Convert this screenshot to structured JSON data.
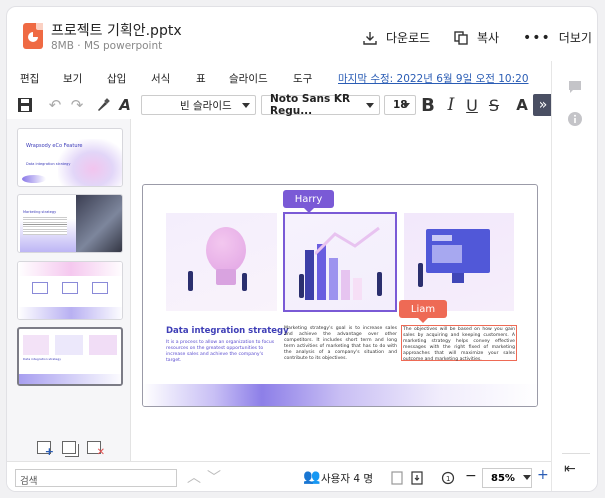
{
  "header": {
    "file_name": "프로젝트 기획안.pptx",
    "file_meta": "8MB · MS powerpoint",
    "download_label": "다운로드",
    "copy_label": "복사",
    "more_label": "더보기"
  },
  "menu": {
    "items": [
      "편집",
      "보기",
      "삽입",
      "서식",
      "표",
      "슬라이드",
      "도구"
    ],
    "last_edit": "마지막 수정: 2022년 6월 9일 오전 10:20"
  },
  "toolbar": {
    "layout_value": "빈 슬라이드",
    "font_value": "Noto Sans KR Regu...",
    "size_value": "18"
  },
  "thumbnails": [
    {
      "title": "Wrapsody eCo Feature",
      "subtitle": "Data integration strategy"
    },
    {
      "title": "Marketing strategy"
    },
    {
      "title": ""
    },
    {
      "title": "Data integration strategy"
    }
  ],
  "slide": {
    "heading": "Data integration strategy",
    "subtext": "It is a process to allow an organization to focus resources on the greatest opportunities to increase sales and achieve the company's target.",
    "middle_text": "Marketing strategy's goal is to increase sales and achieve the advantage over other competitors. It includes short term and long term activities of marketing that has to do with the analysis of a company's situation and contribute to its objectives.",
    "right_text": "The objectives will be based on how you gain sales by acquiring and keeping customers. A marketing strategy helps convey effective messages with the right fixed of marketing approaches that will maximize your sales outcome and marketing activities.",
    "collaborator_harry": "Harry",
    "collaborator_liam": "Liam"
  },
  "status": {
    "search_placeholder": "검색",
    "users_label": "사용자 4 명",
    "zoom_value": "85%"
  },
  "colors": {
    "accent_purple": "#7a5ad6",
    "liam_orange": "#ee6a55",
    "link_blue": "#2b5db5",
    "file_orange": "#ef6a43"
  }
}
